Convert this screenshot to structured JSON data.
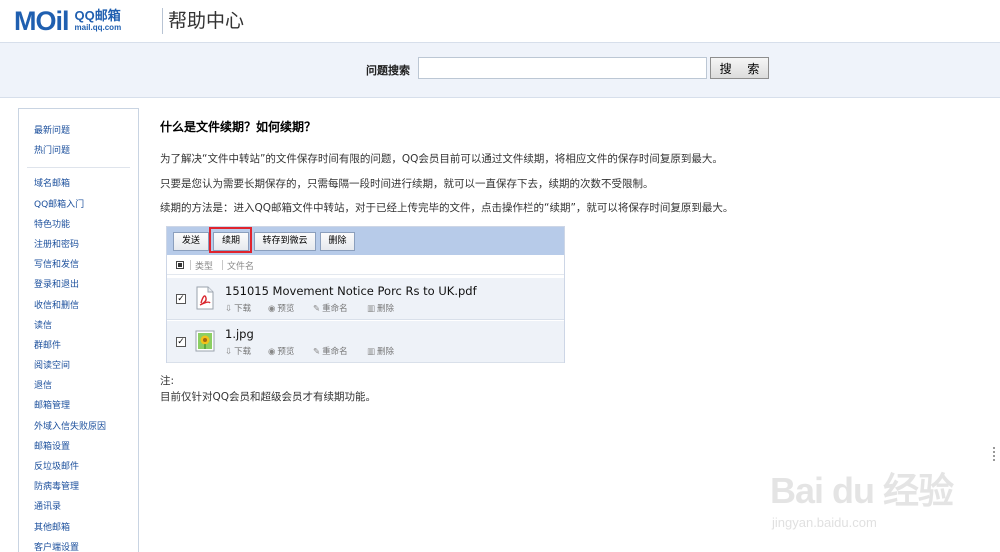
{
  "header": {
    "logo_word": "MOil",
    "logo_qq": "QQ邮箱",
    "logo_domain": "mail.qq.com",
    "help_title": "帮助中心"
  },
  "search": {
    "label": "问题搜索",
    "value": "",
    "button": "搜 索"
  },
  "sidebar": {
    "group1": [
      "最新问题",
      "热门问题"
    ],
    "group2": [
      "域名邮箱",
      "QQ邮箱入门",
      "特色功能",
      "注册和密码",
      "写信和发信",
      "登录和退出",
      "收信和删信",
      "读信",
      "群邮件",
      "阅读空间",
      "退信",
      "邮箱管理",
      "外域入信失败原因",
      "邮箱设置",
      "反垃圾邮件",
      "防病毒管理",
      "通讯录",
      "其他邮箱",
      "客户端设置"
    ]
  },
  "article": {
    "title": "什么是文件续期？如何续期？",
    "p1": "为了解决“文件中转站”的文件保存时间有限的问题，QQ会员目前可以通过文件续期，将相应文件的保存时间复原到最大。",
    "p2": "只要是您认为需要长期保存的，只需每隔一段时间进行续期，就可以一直保存下去，续期的次数不受限制。",
    "p3": "续期的方法是：进入QQ邮箱文件中转站，对于已经上传完毕的文件，点击操作栏的“续期”，就可以将保存时间复原到最大。",
    "note_label": "注:",
    "note_text": "目前仅针对QQ会员和超级会员才有续期功能。"
  },
  "screenshot": {
    "toolbar": [
      "发送",
      "续期",
      "转存到微云",
      "删除"
    ],
    "header_type": "类型",
    "header_name": "文件名",
    "check_mark": "✓",
    "files": [
      {
        "name": "151015 Movement Notice Porc Rs to UK.pdf",
        "icon": "pdf-icon"
      },
      {
        "name": "1.jpg",
        "icon": "image-icon"
      }
    ],
    "actions": [
      "下载",
      "预览",
      "重命名",
      "删除"
    ]
  },
  "watermark": {
    "brand": "Bai du 经验",
    "url": "jingyan.baidu.com"
  },
  "colors": {
    "link": "#1b4f9c",
    "toolbar_bg": "#b7cbe9",
    "highlight": "#e0232d",
    "search_bg": "#eff3fa"
  }
}
